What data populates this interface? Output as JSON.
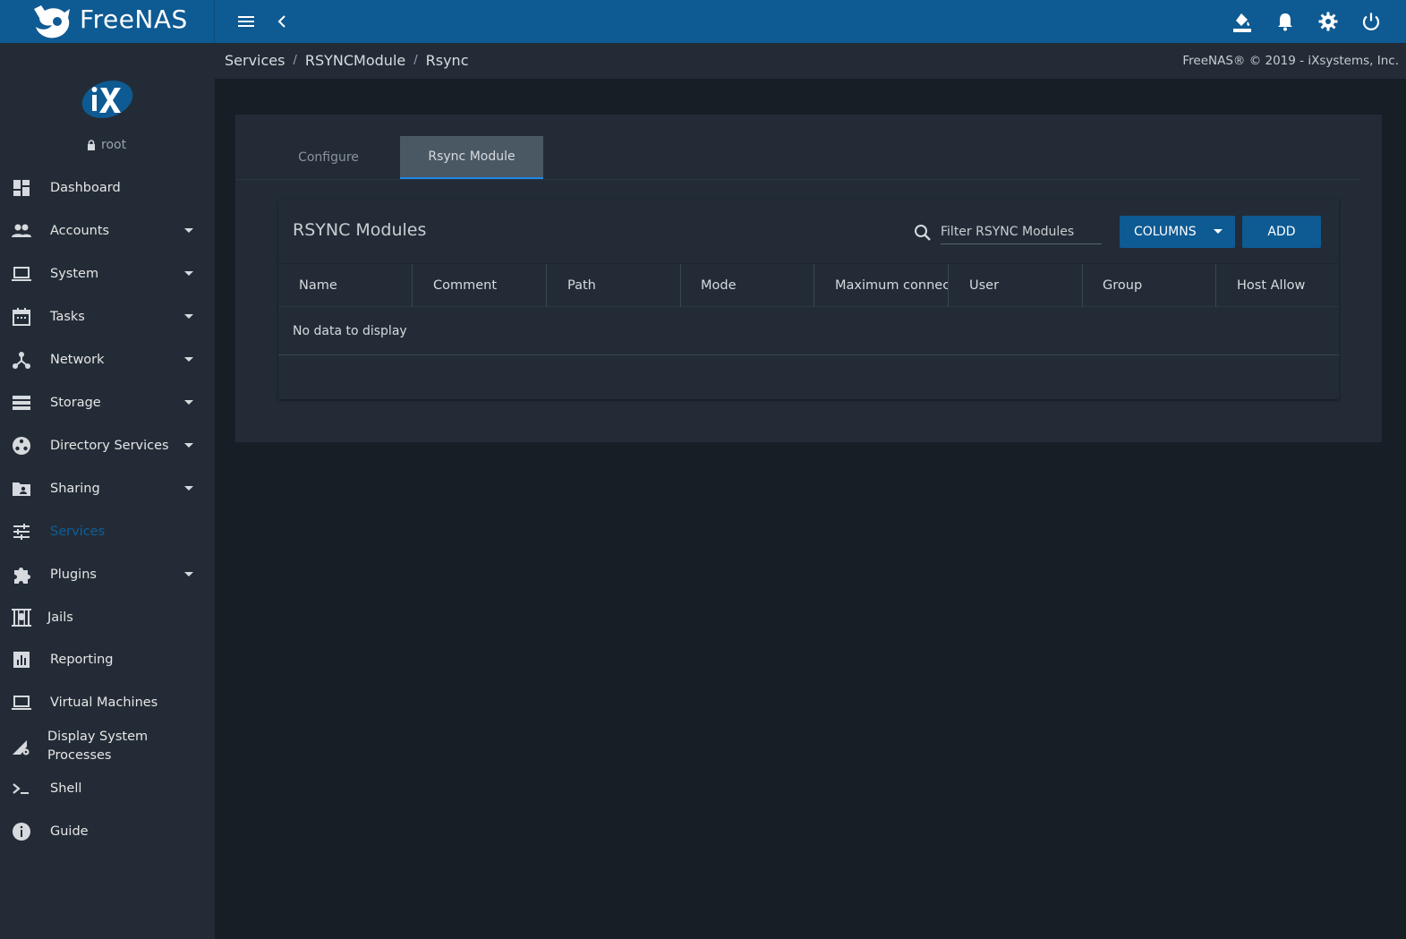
{
  "brand": {
    "name": "FreeNAS",
    "tm": "™"
  },
  "topbar": {
    "icons": [
      "menu-icon",
      "chevron-left-icon",
      "theme-paint-icon",
      "bell-icon",
      "gear-icon",
      "power-icon"
    ],
    "color": "#0e5a93"
  },
  "user": {
    "name": "root"
  },
  "sidebar": {
    "items": [
      {
        "label": "Dashboard",
        "icon": "dashboard-icon",
        "caret": false
      },
      {
        "label": "Accounts",
        "icon": "people-icon",
        "caret": true
      },
      {
        "label": "System",
        "icon": "laptop-icon",
        "caret": true
      },
      {
        "label": "Tasks",
        "icon": "calendar-icon",
        "caret": true
      },
      {
        "label": "Network",
        "icon": "network-icon",
        "caret": true
      },
      {
        "label": "Storage",
        "icon": "storage-icon",
        "caret": true
      },
      {
        "label": "Directory Services",
        "icon": "directory-icon",
        "caret": true
      },
      {
        "label": "Sharing",
        "icon": "folder-shared-icon",
        "caret": true
      },
      {
        "label": "Services",
        "icon": "tune-icon",
        "caret": false,
        "active": true
      },
      {
        "label": "Plugins",
        "icon": "puzzle-icon",
        "caret": true
      },
      {
        "label": "Jails",
        "icon": "jail-icon",
        "caret": false
      },
      {
        "label": "Reporting",
        "icon": "chart-icon",
        "caret": false
      },
      {
        "label": "Virtual Machines",
        "icon": "laptop-icon",
        "caret": false
      },
      {
        "label": "Display System Processes",
        "icon": "processes-icon",
        "caret": false
      },
      {
        "label": "Shell",
        "icon": "shell-icon",
        "caret": false
      },
      {
        "label": "Guide",
        "icon": "info-icon",
        "caret": false
      }
    ],
    "active_color": "#0f5e9c"
  },
  "breadcrumb": [
    "Services",
    "RSYNCModule",
    "Rsync"
  ],
  "copyright": "FreeNAS® © 2019 - iXsystems, Inc.",
  "tabs": [
    {
      "label": "Configure",
      "active": false
    },
    {
      "label": "Rsync Module",
      "active": true
    }
  ],
  "table": {
    "title": "RSYNC Modules",
    "filter_placeholder": "Filter RSYNC Modules",
    "columns_label": "COLUMNS",
    "add_label": "ADD",
    "headers": [
      "Name",
      "Comment",
      "Path",
      "Mode",
      "Maximum connec",
      "User",
      "Group",
      "Host Allow"
    ],
    "empty_message": "No data to display"
  }
}
